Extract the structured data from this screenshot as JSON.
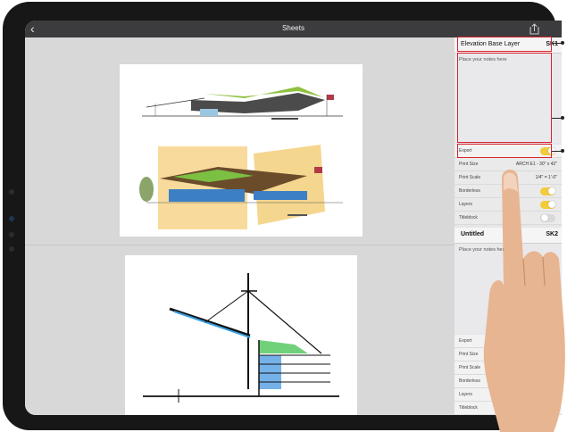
{
  "nav": {
    "title": "Sheets",
    "back_icon": "chevron-left-icon",
    "share_icon": "share-icon"
  },
  "sheets_panel": {
    "sheet1": {
      "title": "Elevation Base Layer",
      "code": "SK1",
      "notes_placeholder": "Place your notes here",
      "export_label": "Export",
      "export_on": true,
      "rows": [
        {
          "label": "Print Size",
          "value": "ARCH E1 - 30\" x 42\"",
          "kind": "value"
        },
        {
          "label": "Print Scale",
          "value": "1/4\" = 1'-0\"",
          "kind": "value"
        },
        {
          "label": "Borderless",
          "on": true,
          "kind": "toggle"
        },
        {
          "label": "Layers",
          "on": true,
          "kind": "toggle"
        },
        {
          "label": "Titleblock",
          "on": false,
          "kind": "toggle"
        }
      ]
    },
    "sheet2": {
      "title": "Untitled",
      "code": "SK2",
      "notes_placeholder": "Place your notes here",
      "rows": [
        {
          "label": "Export"
        },
        {
          "label": "Print Size"
        },
        {
          "label": "Print Scale"
        },
        {
          "label": "Borderless"
        },
        {
          "label": "Layers"
        },
        {
          "label": "Titleblock"
        }
      ]
    }
  },
  "colors": {
    "accent_toggle": "#f2cc3a",
    "callout": "#d9232e",
    "navbar": "#3c3c3e"
  }
}
